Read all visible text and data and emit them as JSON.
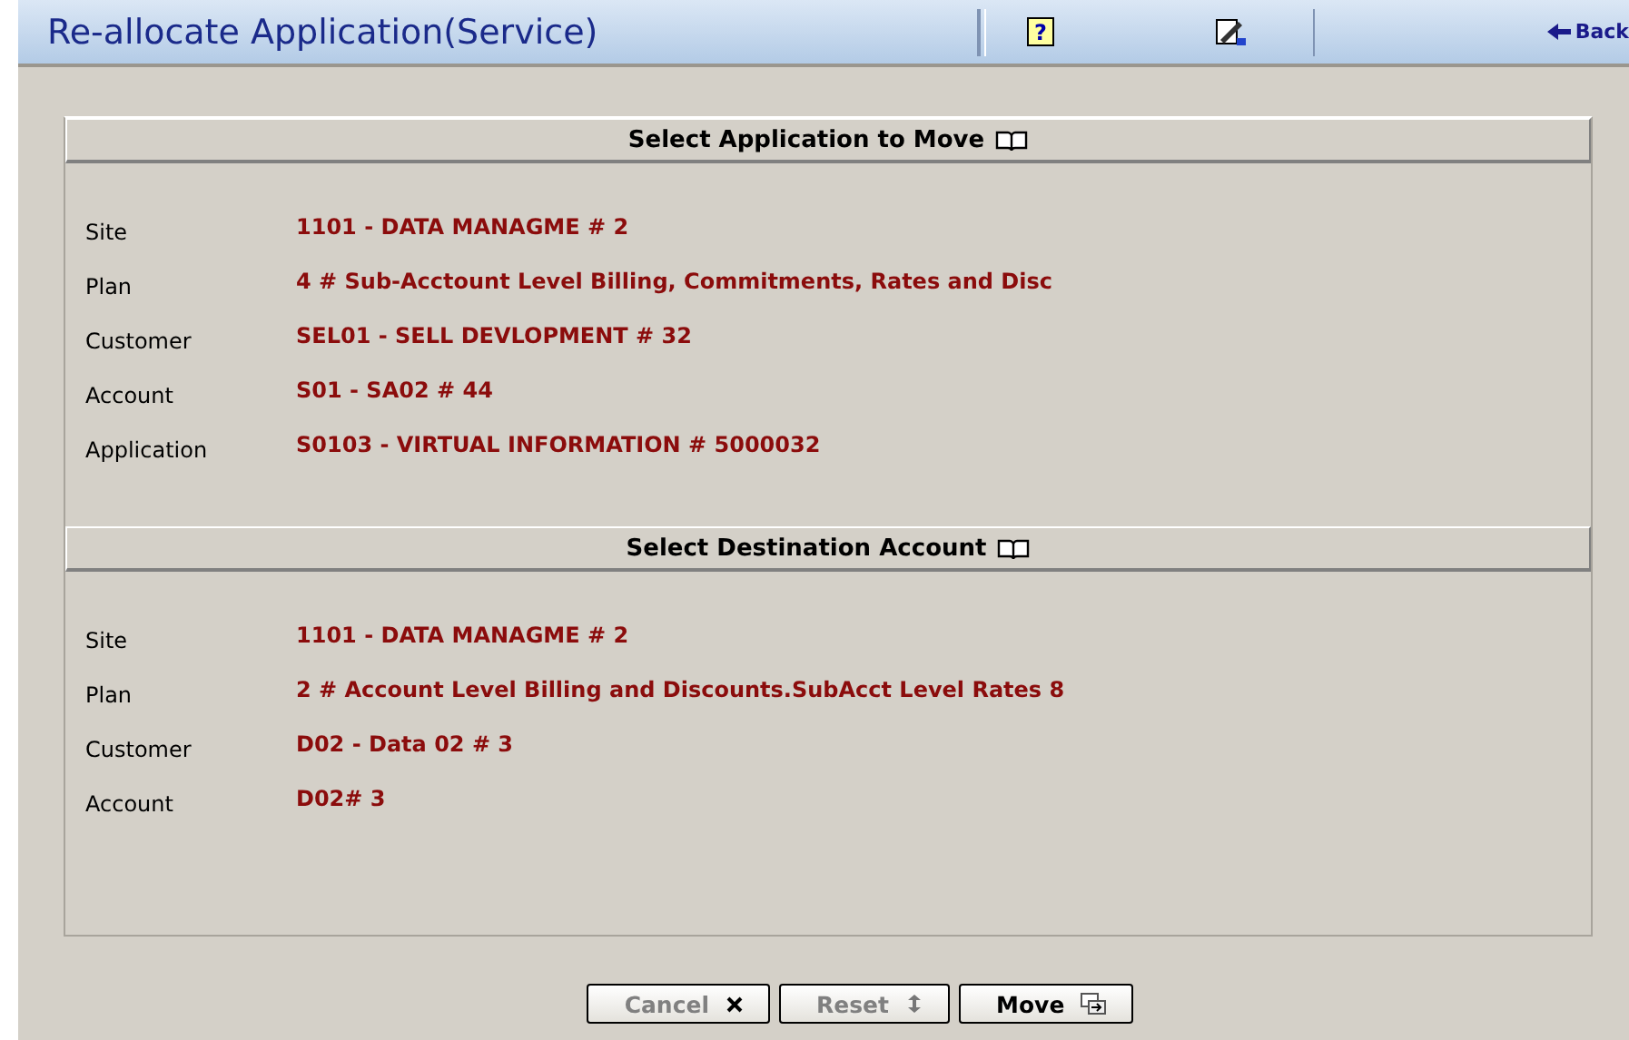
{
  "header": {
    "title": "Re-allocate Application(Service)",
    "back": "Back",
    "help": "?"
  },
  "sections": [
    {
      "title": "Select Application to Move",
      "fields": [
        {
          "label": "Site",
          "value": "1101 - DATA MANAGME # 2"
        },
        {
          "label": "Plan",
          "value": "4 # Sub-Acctount Level Billing, Commitments, Rates and Disc"
        },
        {
          "label": "Customer",
          "value": "SEL01 - SELL DEVLOPMENT # 32"
        },
        {
          "label": "Account",
          "value": "S01 - SA02 # 44"
        },
        {
          "label": "Application",
          "value": "S0103 - VIRTUAL INFORMATION # 5000032"
        }
      ]
    },
    {
      "title": "Select Destination Account",
      "fields": [
        {
          "label": "Site",
          "value": "1101 - DATA MANAGME # 2"
        },
        {
          "label": "Plan",
          "value": "2 # Account Level Billing and Discounts.SubAcct Level Rates 8"
        },
        {
          "label": "Customer",
          "value": "D02 - Data 02 # 3"
        },
        {
          "label": "Account",
          "value": "D02# 3"
        }
      ]
    }
  ],
  "buttons": [
    {
      "label": "Cancel",
      "kind": "cancel",
      "disabled": true
    },
    {
      "label": "Reset",
      "kind": "reset",
      "disabled": true
    },
    {
      "label": "Move",
      "kind": "move",
      "disabled": false
    }
  ]
}
